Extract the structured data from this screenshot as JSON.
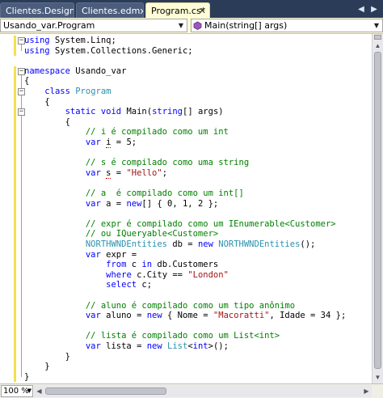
{
  "tabs": [
    {
      "label": "Clientes.Designer.cs",
      "active": false
    },
    {
      "label": "Clientes.edmx",
      "active": false
    },
    {
      "label": "Program.cs*",
      "active": true
    }
  ],
  "navigation": {
    "type_combo": "Usando_var.Program",
    "member_combo": "Main(string[] args)"
  },
  "zoom": "100 %",
  "colors": {
    "keyword": "#0000ff",
    "comment": "#008000",
    "string": "#a31515",
    "type": "#2b91af",
    "change_marker": "#f4e050",
    "background_chrome": "#2b3c59",
    "active_tab": "#fffdd6"
  },
  "icons": [
    "close-icon",
    "scroll-left-icon",
    "scroll-right-icon",
    "class-icon",
    "method-icon",
    "chevron-down-icon"
  ],
  "code": {
    "lines": [
      [
        {
          "t": "using",
          "c": "kw"
        },
        {
          "t": " System.Linq;"
        }
      ],
      [
        {
          "t": "using",
          "c": "kw"
        },
        {
          "t": " System.Collections.Generic;"
        }
      ],
      [],
      [
        {
          "t": "namespace",
          "c": "kw"
        },
        {
          "t": " Usando_var"
        }
      ],
      [
        {
          "t": "{"
        }
      ],
      [
        {
          "t": "    "
        },
        {
          "t": "class",
          "c": "kw"
        },
        {
          "t": " "
        },
        {
          "t": "Program",
          "c": "ty"
        }
      ],
      [
        {
          "t": "    {"
        }
      ],
      [
        {
          "t": "        "
        },
        {
          "t": "static",
          "c": "kw"
        },
        {
          "t": " "
        },
        {
          "t": "void",
          "c": "kw"
        },
        {
          "t": " Main("
        },
        {
          "t": "string",
          "c": "kw"
        },
        {
          "t": "[] args)"
        }
      ],
      [
        {
          "t": "        {"
        }
      ],
      [
        {
          "t": "            "
        },
        {
          "t": "// i é compilado como um int",
          "c": "cm"
        }
      ],
      [
        {
          "t": "            "
        },
        {
          "t": "var",
          "c": "kw"
        },
        {
          "t": " "
        },
        {
          "t": "i",
          "c": "sq"
        },
        {
          "t": " = 5;"
        }
      ],
      [],
      [
        {
          "t": "            "
        },
        {
          "t": "// s é compilado como uma string",
          "c": "cm"
        }
      ],
      [
        {
          "t": "            "
        },
        {
          "t": "var",
          "c": "kw"
        },
        {
          "t": " "
        },
        {
          "t": "s",
          "c": "sq"
        },
        {
          "t": " = "
        },
        {
          "t": "\"Hello\"",
          "c": "st"
        },
        {
          "t": ";"
        }
      ],
      [],
      [
        {
          "t": "            "
        },
        {
          "t": "// a  é compilado como um int[]",
          "c": "cm"
        }
      ],
      [
        {
          "t": "            "
        },
        {
          "t": "var",
          "c": "kw"
        },
        {
          "t": " a = "
        },
        {
          "t": "new",
          "c": "kw"
        },
        {
          "t": "[] { 0, 1, 2 };"
        }
      ],
      [],
      [
        {
          "t": "            "
        },
        {
          "t": "// expr é compilado como um IEnumerable<Customer>",
          "c": "cm"
        }
      ],
      [
        {
          "t": "            "
        },
        {
          "t": "// ou IQueryable<Customer>",
          "c": "cm"
        }
      ],
      [
        {
          "t": "            "
        },
        {
          "t": "NORTHWNDEntities",
          "c": "ty"
        },
        {
          "t": " db = "
        },
        {
          "t": "new",
          "c": "kw"
        },
        {
          "t": " "
        },
        {
          "t": "NORTHWNDEntities",
          "c": "ty"
        },
        {
          "t": "();"
        }
      ],
      [
        {
          "t": "            "
        },
        {
          "t": "var",
          "c": "kw"
        },
        {
          "t": " expr ="
        }
      ],
      [
        {
          "t": "                "
        },
        {
          "t": "from",
          "c": "kw"
        },
        {
          "t": " c "
        },
        {
          "t": "in",
          "c": "kw"
        },
        {
          "t": " db.Customers"
        }
      ],
      [
        {
          "t": "                "
        },
        {
          "t": "where",
          "c": "kw"
        },
        {
          "t": " c.City == "
        },
        {
          "t": "\"London\"",
          "c": "st"
        }
      ],
      [
        {
          "t": "                "
        },
        {
          "t": "select",
          "c": "kw"
        },
        {
          "t": " c;"
        }
      ],
      [],
      [
        {
          "t": "            "
        },
        {
          "t": "// aluno é compilado como um tipo anônimo",
          "c": "cm"
        }
      ],
      [
        {
          "t": "            "
        },
        {
          "t": "var",
          "c": "kw"
        },
        {
          "t": " aluno = "
        },
        {
          "t": "new",
          "c": "kw"
        },
        {
          "t": " { Nome = "
        },
        {
          "t": "\"Macoratti\"",
          "c": "st"
        },
        {
          "t": ", Idade = 34 };"
        }
      ],
      [],
      [
        {
          "t": "            "
        },
        {
          "t": "// lista é compilado como um List<int>",
          "c": "cm"
        }
      ],
      [
        {
          "t": "            "
        },
        {
          "t": "var",
          "c": "kw"
        },
        {
          "t": " lista = "
        },
        {
          "t": "new",
          "c": "kw"
        },
        {
          "t": " "
        },
        {
          "t": "List",
          "c": "ty"
        },
        {
          "t": "<"
        },
        {
          "t": "int",
          "c": "kw"
        },
        {
          "t": ">();"
        }
      ],
      [
        {
          "t": "        }"
        }
      ],
      [
        {
          "t": "    }"
        }
      ],
      [
        {
          "t": "}"
        }
      ]
    ]
  }
}
